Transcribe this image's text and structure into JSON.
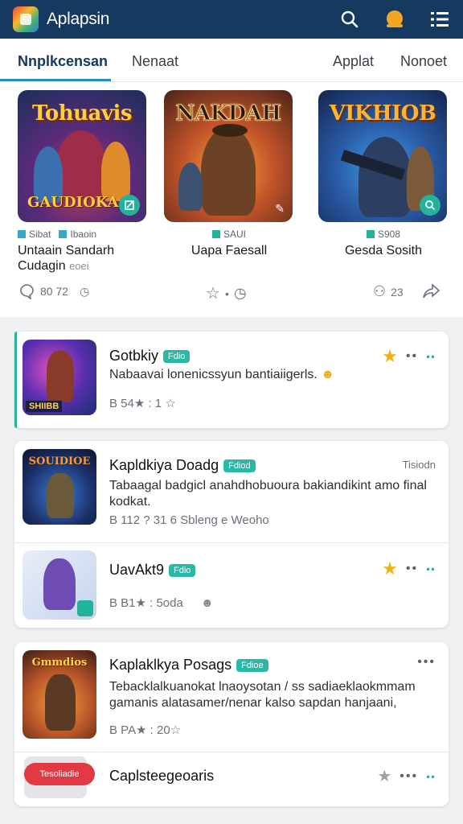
{
  "header": {
    "title": "Aplapsin"
  },
  "tabs": [
    {
      "label": "Nnplkcensan"
    },
    {
      "label": "Nenaat"
    },
    {
      "label": "Applat"
    },
    {
      "label": "Nonoet"
    }
  ],
  "featured": [
    {
      "art_title": "Tohuavis",
      "art_sub": "GAUDIOKA",
      "meta": "Sibat",
      "meta2": "Ibaoin",
      "name": "Untaain Sandarh",
      "sub": "Cudagin",
      "sub_gray": "eoei"
    },
    {
      "art_title": "NAKDAH",
      "meta": "SAUI",
      "name": "Uapa Faesall"
    },
    {
      "art_title": "VIKHIOB",
      "meta": "S908",
      "name": "Gesda Sosith"
    }
  ],
  "actions": [
    {
      "text": "80 72"
    },
    {
      "text": ""
    },
    {
      "text": "23"
    },
    {
      "text": ""
    }
  ],
  "list": [
    {
      "name": "Gotbkiy",
      "pill": "Fdio",
      "desc": "Nabaavai lonenicssyun bantiaiigerls.",
      "stats": "B 54★ : 1 ☆",
      "thumb_label": "SHIIBB"
    },
    {
      "name": "Kapldkiya Doadg",
      "pill": "Fdiod",
      "desc": "Tabaagal badgicl anahdhobuoura bakiandikint amo final kodkat.",
      "stats": "B 112 ? 31 6 Sbleng e Weoho",
      "right_text": "Tisiodn",
      "thumb_label": "SOUIDIOE"
    },
    {
      "name": "UavAkt9",
      "pill": "Fdio",
      "stats": "B B1★ : 5oda"
    },
    {
      "name": "Kaplaklkya Posags",
      "pill": "Fdioe",
      "desc": "Tebacklalkuanokat lnaoysotan / ss sadiaeklaokmmam gamanis alatasamer/nenar kalso sapdan hanjaani,",
      "stats": "B PA★ : 20☆",
      "thumb_label": "Gmmdios"
    },
    {
      "name": "Caplsteegeoaris",
      "button": "Tesoliadie"
    }
  ],
  "colors": {
    "header_bg": "#16395f",
    "accent": "#2a8fc8",
    "teal": "#22b39a",
    "gold": "#f1b114",
    "red": "#e23a44"
  }
}
